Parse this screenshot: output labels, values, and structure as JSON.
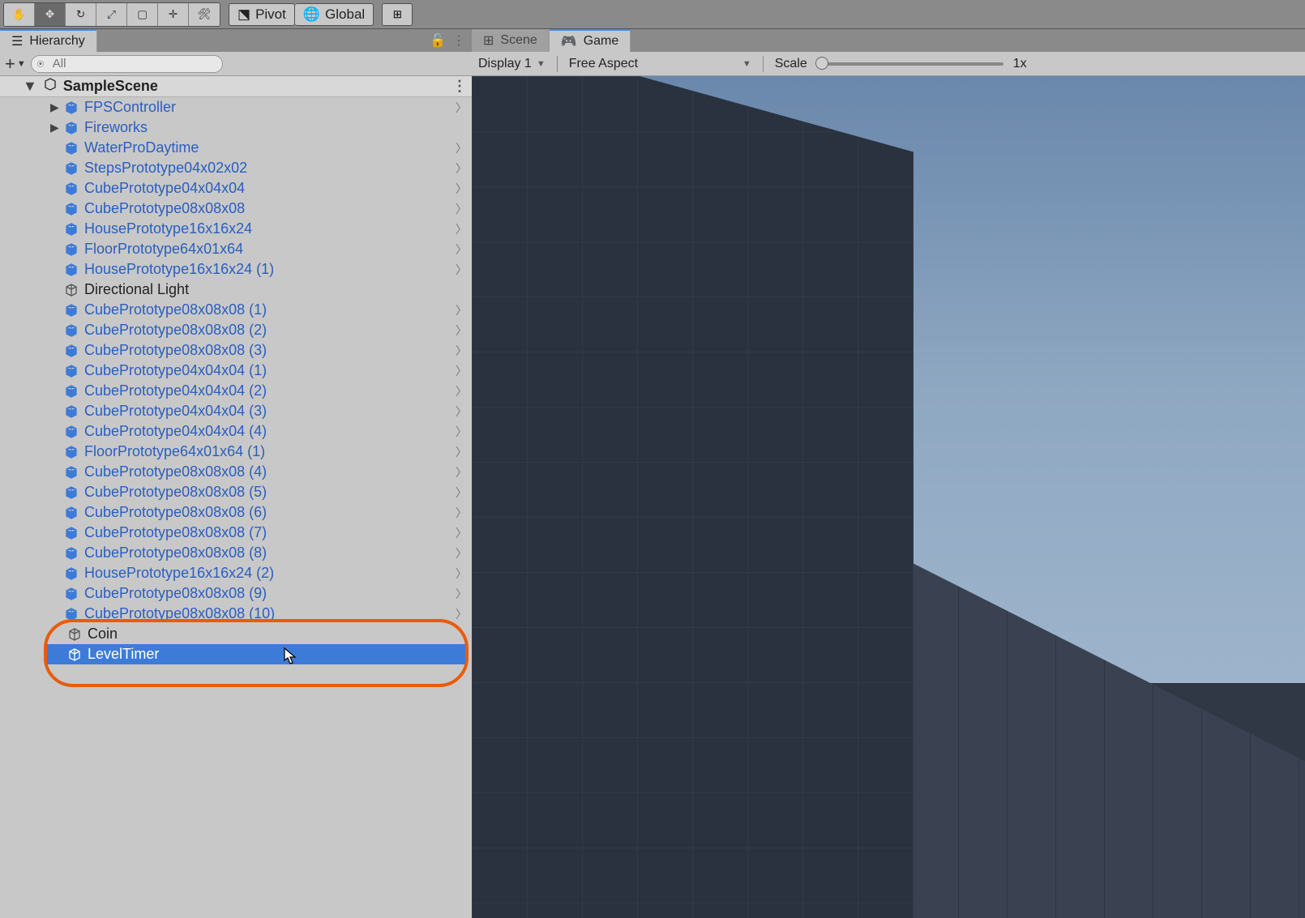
{
  "toolbar": {
    "pivot_label": "Pivot",
    "global_label": "Global"
  },
  "hierarchy": {
    "tab_label": "Hierarchy",
    "search_placeholder": "All",
    "scene_name": "SampleScene",
    "items": [
      {
        "name": "FPSController",
        "prefab": true,
        "expandable": true,
        "chev": true
      },
      {
        "name": "Fireworks",
        "prefab": true,
        "expandable": true,
        "chev": false
      },
      {
        "name": "WaterProDaytime",
        "prefab": true,
        "expandable": false,
        "chev": true
      },
      {
        "name": "StepsPrototype04x02x02",
        "prefab": true,
        "expandable": false,
        "chev": true
      },
      {
        "name": "CubePrototype04x04x04",
        "prefab": true,
        "expandable": false,
        "chev": true
      },
      {
        "name": "CubePrototype08x08x08",
        "prefab": true,
        "expandable": false,
        "chev": true
      },
      {
        "name": "HousePrototype16x16x24",
        "prefab": true,
        "expandable": false,
        "chev": true
      },
      {
        "name": "FloorPrototype64x01x64",
        "prefab": true,
        "expandable": false,
        "chev": true
      },
      {
        "name": "HousePrototype16x16x24 (1)",
        "prefab": true,
        "expandable": false,
        "chev": true
      },
      {
        "name": "Directional Light",
        "prefab": false,
        "expandable": false,
        "chev": false
      },
      {
        "name": "CubePrototype08x08x08 (1)",
        "prefab": true,
        "expandable": false,
        "chev": true
      },
      {
        "name": "CubePrototype08x08x08 (2)",
        "prefab": true,
        "expandable": false,
        "chev": true
      },
      {
        "name": "CubePrototype08x08x08 (3)",
        "prefab": true,
        "expandable": false,
        "chev": true
      },
      {
        "name": "CubePrototype04x04x04 (1)",
        "prefab": true,
        "expandable": false,
        "chev": true
      },
      {
        "name": "CubePrototype04x04x04 (2)",
        "prefab": true,
        "expandable": false,
        "chev": true
      },
      {
        "name": "CubePrototype04x04x04 (3)",
        "prefab": true,
        "expandable": false,
        "chev": true
      },
      {
        "name": "CubePrototype04x04x04 (4)",
        "prefab": true,
        "expandable": false,
        "chev": true
      },
      {
        "name": "FloorPrototype64x01x64 (1)",
        "prefab": true,
        "expandable": false,
        "chev": true
      },
      {
        "name": "CubePrototype08x08x08 (4)",
        "prefab": true,
        "expandable": false,
        "chev": true
      },
      {
        "name": "CubePrototype08x08x08 (5)",
        "prefab": true,
        "expandable": false,
        "chev": true
      },
      {
        "name": "CubePrototype08x08x08 (6)",
        "prefab": true,
        "expandable": false,
        "chev": true
      },
      {
        "name": "CubePrototype08x08x08 (7)",
        "prefab": true,
        "expandable": false,
        "chev": true
      },
      {
        "name": "CubePrototype08x08x08 (8)",
        "prefab": true,
        "expandable": false,
        "chev": true
      },
      {
        "name": "HousePrototype16x16x24 (2)",
        "prefab": true,
        "expandable": false,
        "chev": true
      },
      {
        "name": "CubePrototype08x08x08 (9)",
        "prefab": true,
        "expandable": false,
        "chev": true
      },
      {
        "name": "CubePrototype08x08x08 (10)",
        "prefab": true,
        "expandable": false,
        "chev": true
      }
    ],
    "highlighted": [
      {
        "name": "Coin",
        "prefab": false,
        "selected": false
      },
      {
        "name": "LevelTimer",
        "prefab": false,
        "selected": true
      }
    ]
  },
  "viewport": {
    "scene_tab": "Scene",
    "game_tab": "Game",
    "display_label": "Display 1",
    "aspect_label": "Free Aspect",
    "scale_label": "Scale",
    "scale_value": "1x"
  }
}
